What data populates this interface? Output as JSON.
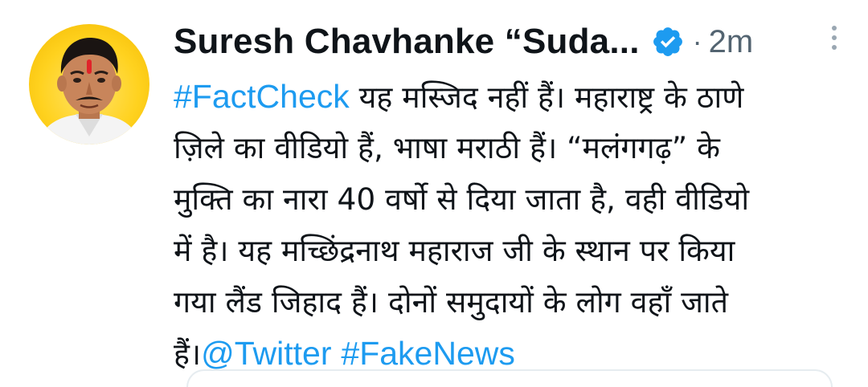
{
  "author": {
    "name": "Suresh Chavhanke “Suda...",
    "verified_icon": "verified-badge-icon"
  },
  "meta": {
    "separator": "·",
    "timestamp": "2m"
  },
  "colors": {
    "link": "#1d9bf0",
    "text": "#0f1419",
    "muted": "#536471",
    "avatar_bg": "#ffd21f"
  },
  "body": {
    "line1_hashtag": "#FactCheck",
    "line1_text": " यह मस्जिद नहीं हैं। महाराष्ट्र के ठाणे",
    "line2_text": "ज़िले का वीडियो हैं, भाषा मराठी हैं। “मलंगगढ़” के",
    "line3_text": "मुक्ति का नारा 40 वर्षो से दिया जाता है, वही वीडियो",
    "line4_text": "में है। यह मच्छिंद्रनाथ महाराज जी के स्थान पर किया",
    "line5_text": "गया लैंड जिहाद हैं। दोनों समुदायों के लोग वहाँ जाते",
    "line6_text": "हैं।",
    "mention": "@Twitter",
    "line6_gap": " ",
    "hashtag_fake": "#FakeNews"
  }
}
